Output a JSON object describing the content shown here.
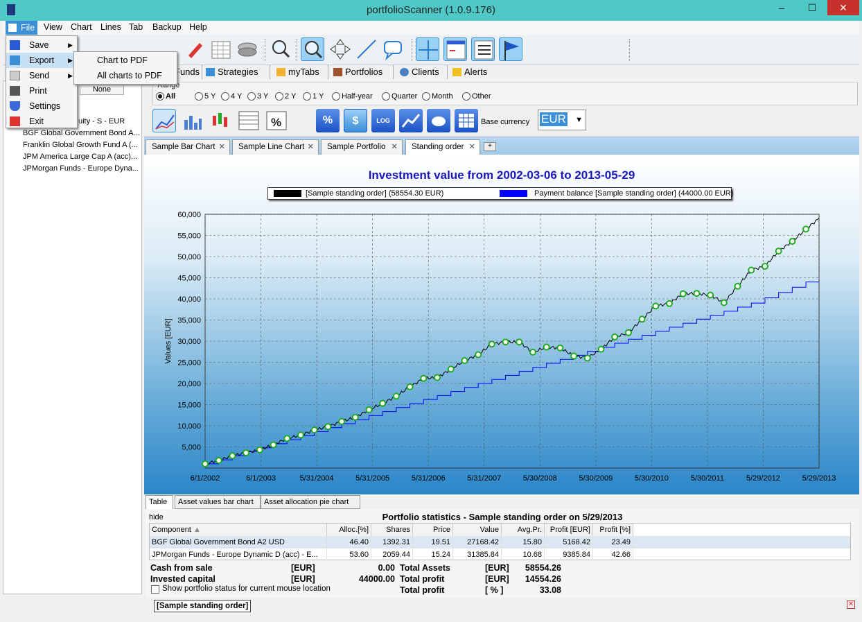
{
  "window": {
    "title": "portfolioScanner (1.0.9.176)",
    "minimize": "–",
    "maximize": "☐",
    "close": "✕"
  },
  "menu": [
    "File",
    "View",
    "Chart",
    "Lines",
    "Tab",
    "Backup",
    "Help"
  ],
  "file_menu": {
    "items": [
      "Save",
      "Export",
      "Send",
      "Print",
      "Settings",
      "Exit"
    ],
    "export_submenu": [
      "Chart to PDF",
      "All charts to PDF"
    ]
  },
  "main_tabs": [
    "Funds",
    "Strategies",
    "myTabs",
    "Portfolios",
    "Clients",
    "Alerts"
  ],
  "left_panel": {
    "header_button": "None",
    "items": [
      "uity - S - EUR",
      "BGF Global Government Bond A...",
      "Franklin Global Growth Fund A (...",
      "JPM America Large Cap A (acc)...",
      "JPMorgan Funds - Europe Dyna..."
    ]
  },
  "range": {
    "label": "Range",
    "options": [
      "All",
      "5 Y",
      "4 Y",
      "3 Y",
      "2 Y",
      "1 Y",
      "Half-year",
      "Quarter",
      "Month",
      "Other"
    ],
    "selected": "All"
  },
  "toolbar2": {
    "percent": "%",
    "dollar": "$",
    "log": "LOG"
  },
  "currency": {
    "label": "Base currency",
    "value": "EUR"
  },
  "chart_tabs": [
    {
      "label": "Sample Bar Chart",
      "close": "✕"
    },
    {
      "label": "Sample Line Chart",
      "close": "✕"
    },
    {
      "label": "Sample Portfolio",
      "close": "✕"
    },
    {
      "label": "Standing order",
      "close": "✕"
    }
  ],
  "chart_data": {
    "type": "line",
    "title": "Investment value from 2002-03-06 to 2013-05-29",
    "ylabel": "Values [EUR]",
    "xlabel": "",
    "ylim": [
      0,
      60000
    ],
    "grid": true,
    "legend_position": "top",
    "yticks": [
      "5,000",
      "10,000",
      "15,000",
      "20,000",
      "25,000",
      "30,000",
      "35,000",
      "40,000",
      "45,000",
      "50,000",
      "55,000",
      "60,000"
    ],
    "xticks": [
      "6/1/2002",
      "6/1/2003",
      "5/31/2004",
      "5/31/2005",
      "5/31/2006",
      "5/31/2007",
      "5/30/2008",
      "5/30/2009",
      "5/30/2010",
      "5/30/2011",
      "5/29/2012",
      "5/29/2013"
    ],
    "series": [
      {
        "name": "[Sample standing order] (58554.30 EUR)",
        "color": "#000000",
        "x": [
          2002.17,
          2002.42,
          2002.67,
          2002.92,
          2003.17,
          2003.42,
          2003.67,
          2003.92,
          2004.17,
          2004.42,
          2004.67,
          2004.92,
          2005.17,
          2005.42,
          2005.67,
          2005.92,
          2006.17,
          2006.42,
          2006.67,
          2006.92,
          2007.17,
          2007.42,
          2007.67,
          2007.92,
          2008.17,
          2008.42,
          2008.67,
          2008.92,
          2009.17,
          2009.42,
          2009.67,
          2009.92,
          2010.17,
          2010.42,
          2010.67,
          2010.92,
          2011.17,
          2011.42,
          2011.67,
          2011.92,
          2012.17,
          2012.42,
          2012.67,
          2012.92,
          2013.17,
          2013.41
        ],
        "y": [
          1000,
          1800,
          2900,
          3600,
          4300,
          5500,
          7000,
          7800,
          9000,
          9800,
          11000,
          12000,
          13800,
          15300,
          17000,
          19200,
          21200,
          21400,
          23400,
          25400,
          26800,
          29300,
          29800,
          29800,
          27400,
          28600,
          28400,
          26500,
          26000,
          28100,
          31000,
          32000,
          35200,
          38300,
          38900,
          41200,
          41300,
          40900,
          39100,
          43000,
          46800,
          47700,
          51300,
          53600,
          56500,
          59000
        ]
      },
      {
        "name": "Payment balance [Sample standing order] (44000.00 EUR)",
        "color": "#0000ff",
        "x": [
          2002.17,
          2002.42,
          2002.67,
          2002.92,
          2003.17,
          2003.42,
          2003.67,
          2003.92,
          2004.17,
          2004.42,
          2004.67,
          2004.92,
          2005.17,
          2005.42,
          2005.67,
          2005.92,
          2006.17,
          2006.42,
          2006.67,
          2006.92,
          2007.17,
          2007.42,
          2007.67,
          2007.92,
          2008.17,
          2008.42,
          2008.67,
          2008.92,
          2009.17,
          2009.42,
          2009.67,
          2009.92,
          2010.17,
          2010.42,
          2010.67,
          2010.92,
          2011.17,
          2011.42,
          2011.67,
          2011.92,
          2012.17,
          2012.42,
          2012.67,
          2012.92,
          2013.17,
          2013.41
        ],
        "y": [
          1000,
          1950,
          2900,
          3850,
          4800,
          5750,
          6700,
          7650,
          8600,
          9550,
          10500,
          11450,
          12400,
          13350,
          14300,
          15250,
          16200,
          17150,
          18100,
          19050,
          20000,
          20950,
          21900,
          22850,
          23800,
          24750,
          25700,
          26650,
          27600,
          28550,
          29500,
          30450,
          31400,
          32350,
          33300,
          34250,
          35200,
          36150,
          37100,
          38050,
          39000,
          40250,
          41500,
          42750,
          44000,
          44000
        ]
      }
    ],
    "markers": {
      "stroke": "#22aa22",
      "fill": "#ffffff"
    }
  },
  "bottom_tabs": [
    "Table",
    "Asset values bar chart",
    "Asset allocation pie chart"
  ],
  "stats": {
    "hide": "hide",
    "title": "Portfolio statistics - Sample standing order on 5/29/2013",
    "columns": [
      "Component",
      "Alloc.[%]",
      "Shares",
      "Price",
      "Value",
      "Avg.Pr.",
      "Profit [EUR]",
      "Profit [%]"
    ],
    "rows": [
      [
        "BGF Global Government Bond A2 USD",
        "46.40",
        "1392.31",
        "19.51",
        "27168.42",
        "15.80",
        "5168.42",
        "23.49"
      ],
      [
        "JPMorgan Funds - Europe Dynamic D (acc) - E...",
        "53.60",
        "2059.44",
        "15.24",
        "31385.84",
        "10.68",
        "9385.84",
        "42.66"
      ]
    ],
    "summary": {
      "cash_label": "Cash from sale",
      "cash_unit": "[EUR]",
      "cash_value": "0.00",
      "invested_label": "Invested capital",
      "invested_unit": "[EUR]",
      "invested_value": "44000.00",
      "assets_label": "Total Assets",
      "assets_unit": "[EUR]",
      "assets_value": "58554.26",
      "profit_label": "Total profit",
      "profit_unit": "[EUR]",
      "profit_value": "14554.26",
      "profit_pct_label": "Total profit",
      "profit_pct_unit": "[ % ]",
      "profit_pct_value": "33.08"
    },
    "checkbox_label": "Show portfolio status for current mouse location"
  },
  "status": {
    "pill": "[Sample standing order]",
    "close": "✕"
  }
}
